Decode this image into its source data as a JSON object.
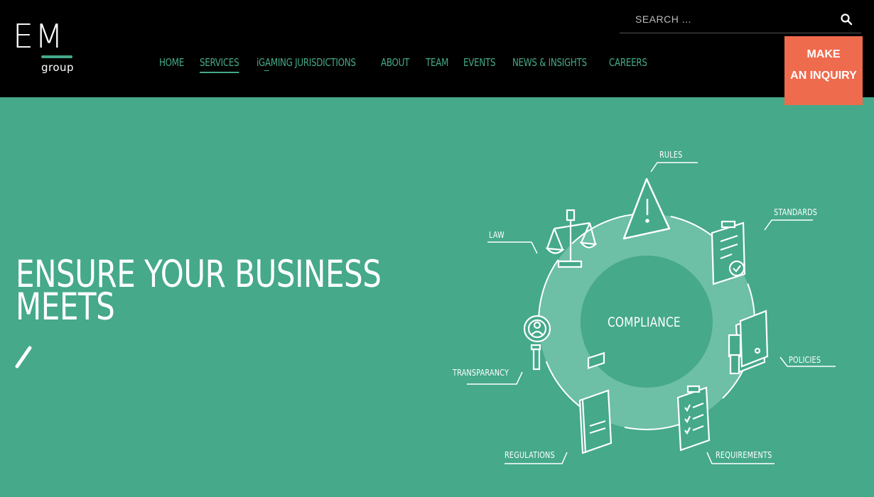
{
  "logo": {
    "mark": "EM",
    "sub": "group"
  },
  "nav": {
    "items": [
      {
        "label": "HOME"
      },
      {
        "label": "SERVICES"
      },
      {
        "label": "iGAMING JURISDICTIONS"
      },
      {
        "label": "ABOUT"
      },
      {
        "label": "TEAM"
      },
      {
        "label": "EVENTS"
      },
      {
        "label": "NEWS & INSIGHTS"
      },
      {
        "label": "CAREERS"
      }
    ],
    "active": "SERVICES"
  },
  "search": {
    "placeholder": "SEARCH ..."
  },
  "inquiry": {
    "line1": "MAKE",
    "line2": "AN INQUIRY"
  },
  "hero": {
    "title": "ENSURE YOUR BUSINESS MEETS"
  },
  "diagram": {
    "center": "COMPLIANCE",
    "labels": {
      "rules": "RULES",
      "standards": "STANDARDS",
      "law": "LAW",
      "policies": "POLICIES",
      "transparancy": "TRANSPARANCY",
      "regulations": "REGULATIONS",
      "requirements": "REQUIREMENTS"
    }
  },
  "colors": {
    "brand": "#45a98a",
    "accent": "#ee6b4e",
    "header": "#000000"
  },
  "icons": [
    "search-icon",
    "scales-icon",
    "warning-icon",
    "clipboard-icon",
    "stamp-icon",
    "person-badge-icon",
    "book-icon",
    "checklist-icon"
  ]
}
